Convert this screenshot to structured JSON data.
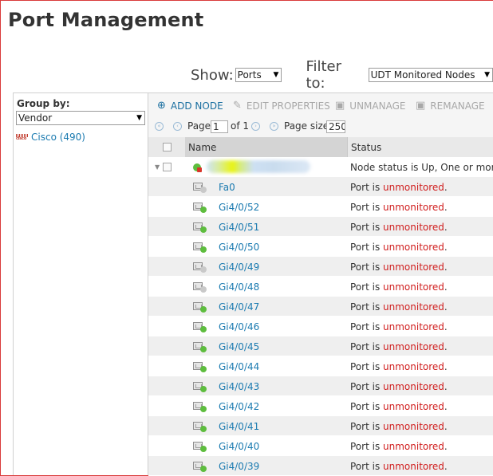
{
  "page": {
    "title": "Port Management"
  },
  "filters": {
    "show_label": "Show:",
    "show_value": "Ports",
    "filter_label": "Filter to:",
    "filter_value": "UDT Monitored Nodes"
  },
  "sidebar": {
    "group_by_label": "Group by:",
    "group_by_value": "Vendor",
    "vendors": [
      {
        "logo_text": "cisco",
        "label": "Cisco (490)"
      }
    ]
  },
  "toolbar": {
    "add_node": "ADD NODE",
    "edit_properties": "EDIT PROPERTIES",
    "unmanage": "UNMANAGE",
    "remanage": "REMANAGE"
  },
  "pager": {
    "page_label": "Page",
    "page_value": "1",
    "of_label": "of 1",
    "page_size_label": "Page size",
    "page_size_value": "250"
  },
  "table": {
    "headers": {
      "name": "Name",
      "status": "Status"
    },
    "node_row": {
      "status": "Node status is Up, One or more"
    },
    "port_status_prefix": "Port is ",
    "port_status_word": "unmonitored",
    "port_status_suffix": ".",
    "rows": [
      {
        "name": "Fa0",
        "state": "unknown"
      },
      {
        "name": "Gi4/0/52",
        "state": "up"
      },
      {
        "name": "Gi4/0/51",
        "state": "up"
      },
      {
        "name": "Gi4/0/50",
        "state": "up"
      },
      {
        "name": "Gi4/0/49",
        "state": "unknown"
      },
      {
        "name": "Gi4/0/48",
        "state": "unknown"
      },
      {
        "name": "Gi4/0/47",
        "state": "up"
      },
      {
        "name": "Gi4/0/46",
        "state": "up"
      },
      {
        "name": "Gi4/0/45",
        "state": "up"
      },
      {
        "name": "Gi4/0/44",
        "state": "up"
      },
      {
        "name": "Gi4/0/43",
        "state": "up"
      },
      {
        "name": "Gi4/0/42",
        "state": "up"
      },
      {
        "name": "Gi4/0/41",
        "state": "up"
      },
      {
        "name": "Gi4/0/40",
        "state": "up"
      },
      {
        "name": "Gi4/0/39",
        "state": "up"
      }
    ]
  },
  "colors": {
    "link": "#1a7ab0",
    "unmonitored": "#d01e1e",
    "status_up": "#5ebd3e",
    "status_unknown": "#c9c9c9",
    "frame_border": "#d93a3a"
  },
  "icons": {
    "add_node": "plus-circle-icon",
    "edit_properties": "pencil-icon",
    "unmanage": "unmanage-icon",
    "remanage": "remanage-icon",
    "first_page": "first-page-icon",
    "prev_page": "prev-page-icon",
    "next_page": "next-page-icon",
    "last_page": "last-page-icon",
    "port": "port-icon",
    "node": "node-status-icon",
    "vendor": "cisco-logo-icon"
  }
}
